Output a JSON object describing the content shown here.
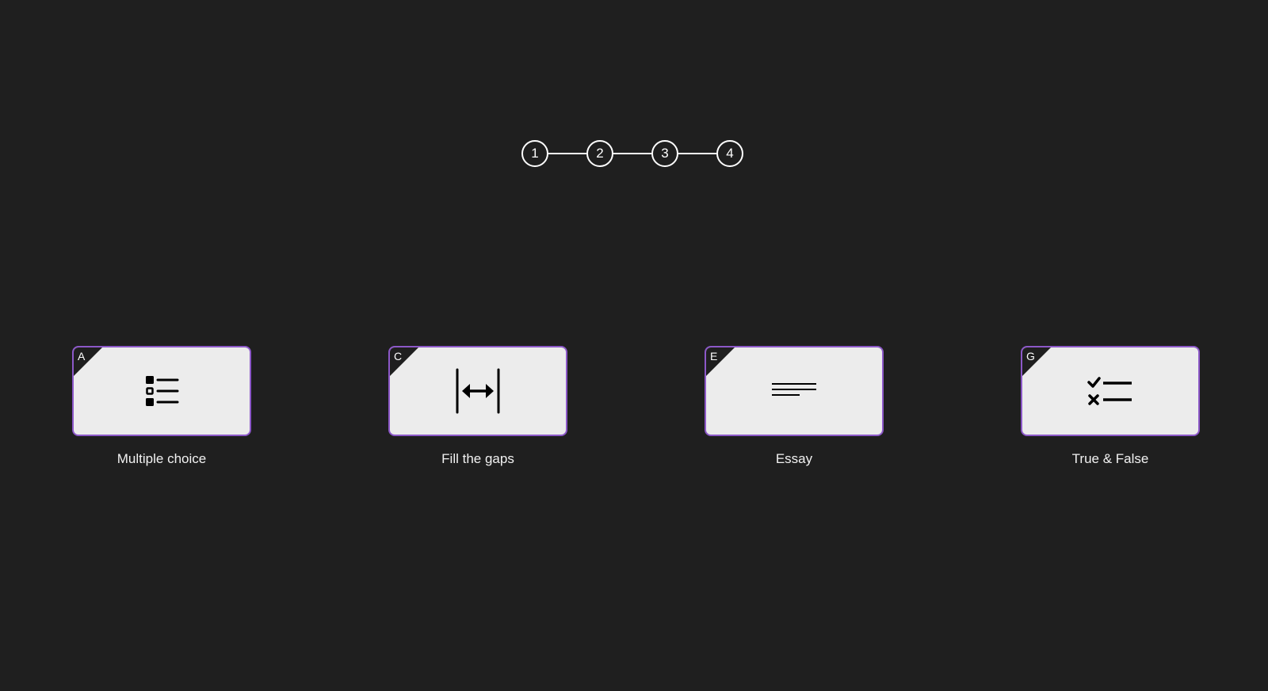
{
  "stepper": {
    "steps": [
      "1",
      "2",
      "3",
      "4"
    ]
  },
  "cards": [
    {
      "key": "A",
      "label": "Multiple choice",
      "icon": "list-checkbox-icon"
    },
    {
      "key": "C",
      "label": "Fill the gaps",
      "icon": "gap-arrows-icon"
    },
    {
      "key": "E",
      "label": "Essay",
      "icon": "text-lines-icon"
    },
    {
      "key": "G",
      "label": "True & False",
      "icon": "check-cross-list-icon"
    }
  ],
  "colors": {
    "background": "#1f1f1f",
    "card_fill": "#ececec",
    "card_border": "#8c58c8",
    "text": "#f2f2f2"
  }
}
